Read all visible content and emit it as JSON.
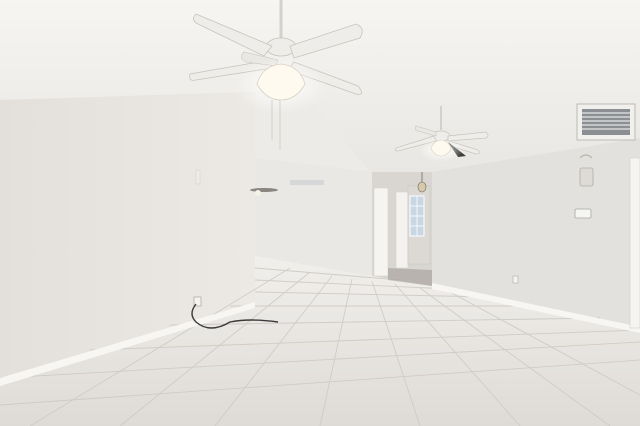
{
  "scene": {
    "subject": "empty-living-room",
    "elements": [
      "vaulted-ceiling",
      "ceiling-fan-left",
      "ceiling-fan-right",
      "ac-vent",
      "thermostat",
      "wall-sconce",
      "hallway-doorway",
      "exterior-door-window",
      "pendant-light",
      "tile-floor",
      "baseboards",
      "power-cord",
      "wall-outlet"
    ]
  },
  "palette": {
    "ceiling": "#f3f1ee",
    "wall_left": "#e8e5e1",
    "wall_right": "#e2e0dd",
    "floor": "#e6e4e0",
    "grout": "#c9c5bf",
    "baseboard": "#f7f6f3",
    "fan_blade": "#efede9",
    "fan_light": "#fffaf0",
    "vent": "#8b8e93",
    "door_trim": "#f5f4f1",
    "window_glass": "#c9d6e3"
  }
}
